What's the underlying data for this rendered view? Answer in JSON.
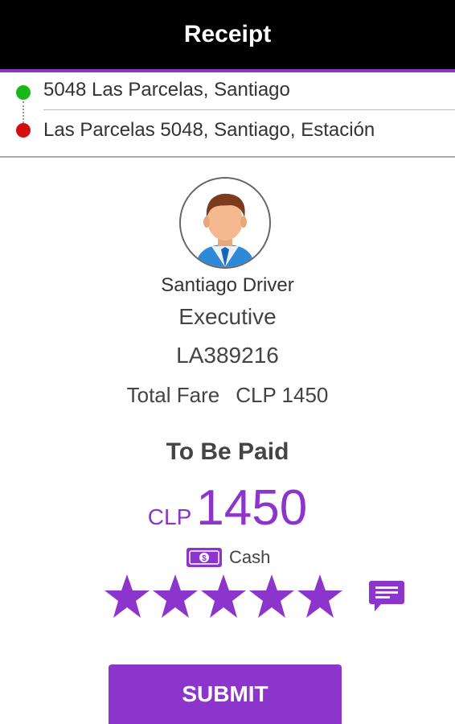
{
  "header": {
    "title": "Receipt"
  },
  "route": {
    "pickup": "5048 Las Parcelas, Santiago",
    "drop": "Las Parcelas 5048, Santiago, Estación"
  },
  "driver": {
    "name": "Santiago Driver",
    "vehicle_type": "Executive",
    "plate": "LA389216"
  },
  "fare": {
    "label": "Total Fare",
    "value": "CLP 1450"
  },
  "payment": {
    "heading": "To Be Paid",
    "currency": "CLP",
    "amount": "1450",
    "method": "Cash"
  },
  "rating": {
    "stars": 5,
    "max": 5
  },
  "actions": {
    "submit_label": "SUBMIT"
  },
  "colors": {
    "accent": "#8c35cc",
    "pickup_dot": "#17b817",
    "drop_dot": "#d10f0f",
    "header_bg": "#000000"
  },
  "icons": {
    "pickup": "green-dot-icon",
    "drop": "red-dot-icon",
    "payment": "cash-icon",
    "comment": "comment-icon",
    "rating": "star-icon"
  }
}
